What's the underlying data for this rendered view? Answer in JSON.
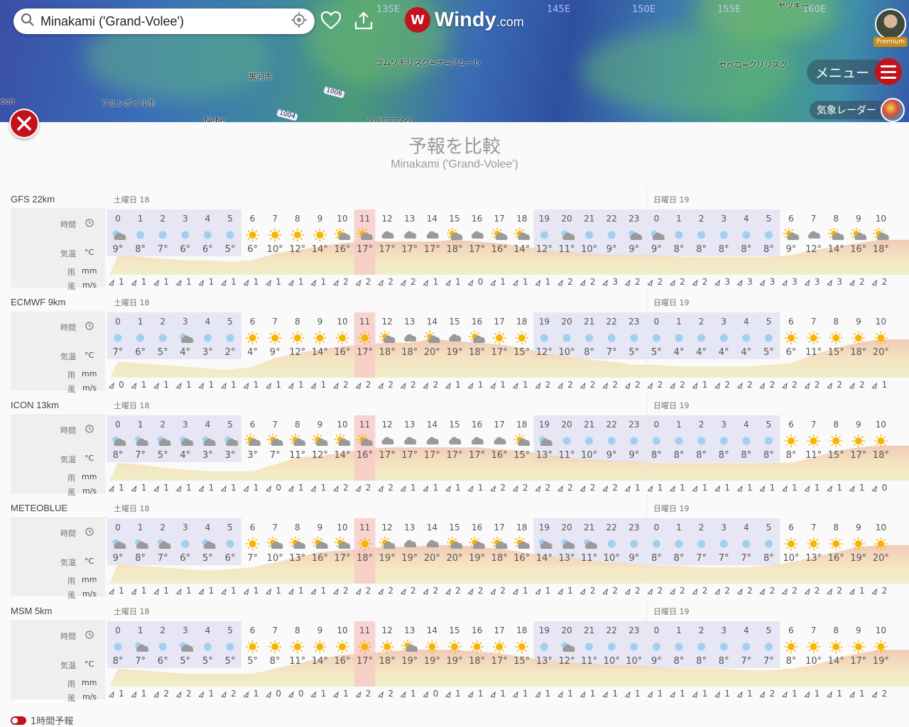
{
  "map": {
    "search_value": "Minakami ('Grand-Volee')",
    "logo_name": "Windy",
    "logo_suffix": ".com",
    "premium_label": "Premium",
    "menu_label": "メニュー",
    "radar_label": "気象レーダー",
    "place_labels": [
      "黒河市",
      "フルンボイル市",
      "コムソモリスク=ナ=アムーレ",
      "セベロ=クリリスク",
      "ヤツキー",
      "ハバロフスク",
      "Nehe",
      "een"
    ],
    "lon_labels": [
      "135E",
      "145E",
      "150E",
      "155E",
      "160E"
    ],
    "isobars": [
      "1006",
      "1004"
    ]
  },
  "page": {
    "title": "予報を比較",
    "subtitle": "Minakami ('Grand-Volee')",
    "toggle_label": "1時間予報"
  },
  "row_labels": {
    "time": "時間",
    "temp": "気温",
    "temp_unit": "°C",
    "rain": "雨",
    "rain_unit": "mm",
    "wind": "風",
    "wind_unit": "m/s"
  },
  "days": [
    "土曜日 18",
    "日曜日 19"
  ],
  "hours": [
    0,
    1,
    2,
    3,
    4,
    5,
    6,
    7,
    8,
    9,
    10,
    11,
    12,
    13,
    14,
    15,
    16,
    17,
    18,
    19,
    20,
    21,
    22,
    23,
    0,
    1,
    2,
    3,
    4,
    5,
    6,
    7,
    8,
    9,
    10
  ],
  "highlight_hour_index": 11,
  "models": [
    {
      "name": "GFS 22km",
      "temps": [
        "9°",
        "8°",
        "7°",
        "6°",
        "6°",
        "5°",
        "6°",
        "10°",
        "12°",
        "14°",
        "16°",
        "17°",
        "17°",
        "17°",
        "17°",
        "18°",
        "17°",
        "16°",
        "14°",
        "12°",
        "11°",
        "10°",
        "9°",
        "9°",
        "9°",
        "8°",
        "8°",
        "8°",
        "8°",
        "8°",
        "9°",
        "12°",
        "14°",
        "16°",
        "18°"
      ],
      "icons": [
        "pc-night",
        "moon",
        "moon",
        "moon",
        "moon",
        "moon",
        "sun",
        "sun",
        "sun",
        "sun",
        "pc-sun",
        "pc-sun",
        "cloud",
        "cloud",
        "cloud",
        "pc-sun",
        "cloud",
        "pc-sun",
        "pc-sun",
        "moon",
        "pc-night",
        "moon",
        "moon",
        "pc-night",
        "pc-night",
        "moon",
        "moon",
        "moon",
        "moon",
        "moon",
        "pc-sun",
        "cloud",
        "pc-sun",
        "pc-sun",
        "pc-sun"
      ],
      "wind": [
        "1",
        "1",
        "1",
        "1",
        "1",
        "1",
        "1",
        "1",
        "1",
        "1",
        "2",
        "2",
        "2",
        "2",
        "1",
        "1",
        "0",
        "1",
        "1",
        "1",
        "2",
        "2",
        "3",
        "2",
        "2",
        "2",
        "2",
        "3",
        "3",
        "3",
        "3",
        "3",
        "3",
        "2",
        "2"
      ]
    },
    {
      "name": "ECMWF 9km",
      "temps": [
        "7°",
        "6°",
        "5°",
        "4°",
        "3°",
        "2°",
        "4°",
        "9°",
        "12°",
        "14°",
        "16°",
        "17°",
        "18°",
        "18°",
        "20°",
        "19°",
        "18°",
        "17°",
        "15°",
        "12°",
        "10°",
        "8°",
        "7°",
        "5°",
        "5°",
        "4°",
        "4°",
        "4°",
        "4°",
        "5°",
        "6°",
        "11°",
        "15°",
        "18°",
        "20°"
      ],
      "icons": [
        "moon",
        "moon",
        "moon",
        "pc-night",
        "moon",
        "moon",
        "sun",
        "sun",
        "sun",
        "sun",
        "sun",
        "sun",
        "pc-sun",
        "cloud",
        "pc-sun",
        "cloud",
        "pc-sun",
        "sun",
        "sun",
        "moon",
        "moon",
        "moon",
        "moon",
        "moon",
        "moon",
        "moon",
        "moon",
        "moon",
        "moon",
        "moon",
        "sun",
        "sun",
        "sun",
        "sun",
        "sun"
      ],
      "wind": [
        "0",
        "1",
        "1",
        "1",
        "1",
        "1",
        "1",
        "1",
        "1",
        "1",
        "2",
        "2",
        "2",
        "2",
        "2",
        "1",
        "1",
        "1",
        "1",
        "2",
        "2",
        "2",
        "2",
        "2",
        "2",
        "2",
        "1",
        "2",
        "2",
        "2",
        "2",
        "2",
        "2",
        "2",
        "1"
      ]
    },
    {
      "name": "ICON 13km",
      "temps": [
        "8°",
        "7°",
        "5°",
        "4°",
        "3°",
        "3°",
        "3°",
        "7°",
        "11°",
        "12°",
        "14°",
        "16°",
        "17°",
        "17°",
        "17°",
        "17°",
        "17°",
        "16°",
        "15°",
        "13°",
        "11°",
        "10°",
        "9°",
        "9°",
        "8°",
        "8°",
        "8°",
        "8°",
        "8°",
        "8°",
        "8°",
        "11°",
        "15°",
        "17°",
        "18°"
      ],
      "icons": [
        "pc-night",
        "pc-night",
        "pc-night",
        "pc-night",
        "pc-night",
        "pc-night",
        "pc-sun",
        "pc-sun",
        "pc-sun",
        "pc-sun",
        "pc-sun",
        "pc-sun",
        "cloud",
        "cloud",
        "cloud",
        "cloud",
        "cloud",
        "cloud",
        "pc-sun",
        "pc-night",
        "moon",
        "moon",
        "moon",
        "moon",
        "moon",
        "moon",
        "moon",
        "moon",
        "moon",
        "moon",
        "sun",
        "sun",
        "sun",
        "sun",
        "sun"
      ],
      "wind": [
        "1",
        "1",
        "1",
        "1",
        "1",
        "1",
        "1",
        "0",
        "1",
        "1",
        "2",
        "2",
        "2",
        "1",
        "1",
        "1",
        "1",
        "2",
        "2",
        "2",
        "2",
        "2",
        "2",
        "1",
        "1",
        "1",
        "1",
        "1",
        "1",
        "1",
        "1",
        "1",
        "1",
        "1",
        "0"
      ]
    },
    {
      "name": "METEOBLUE",
      "temps": [
        "9°",
        "8°",
        "7°",
        "6°",
        "5°",
        "6°",
        "7°",
        "10°",
        "13°",
        "16°",
        "17°",
        "18°",
        "19°",
        "19°",
        "20°",
        "20°",
        "19°",
        "18°",
        "16°",
        "14°",
        "13°",
        "11°",
        "10°",
        "9°",
        "8°",
        "8°",
        "7°",
        "7°",
        "7°",
        "8°",
        "10°",
        "13°",
        "16°",
        "19°",
        "20°"
      ],
      "icons": [
        "pc-night",
        "pc-night",
        "pc-night",
        "moon",
        "pc-night",
        "moon",
        "sun",
        "pc-sun",
        "pc-sun",
        "pc-sun",
        "pc-sun",
        "sun",
        "pc-sun",
        "cloud",
        "cloud",
        "pc-sun",
        "pc-sun",
        "pc-sun",
        "pc-sun",
        "pc-night",
        "pc-night",
        "pc-night",
        "moon",
        "moon",
        "moon",
        "moon",
        "moon",
        "moon",
        "moon",
        "moon",
        "sun",
        "sun",
        "sun",
        "sun",
        "sun"
      ],
      "wind": [
        "1",
        "1",
        "1",
        "1",
        "1",
        "1",
        "1",
        "1",
        "1",
        "1",
        "2",
        "2",
        "2",
        "2",
        "2",
        "2",
        "2",
        "2",
        "1",
        "1",
        "1",
        "2",
        "2",
        "2",
        "2",
        "2",
        "2",
        "2",
        "2",
        "2",
        "2",
        "2",
        "2",
        "1",
        "2"
      ]
    },
    {
      "name": "MSM 5km",
      "temps": [
        "8°",
        "7°",
        "6°",
        "5°",
        "5°",
        "5°",
        "5°",
        "8°",
        "11°",
        "14°",
        "16°",
        "17°",
        "18°",
        "19°",
        "19°",
        "19°",
        "18°",
        "17°",
        "15°",
        "13°",
        "12°",
        "11°",
        "10°",
        "10°",
        "9°",
        "8°",
        "8°",
        "8°",
        "7°",
        "7°",
        "8°",
        "10°",
        "14°",
        "17°",
        "19°"
      ],
      "icons": [
        "moon",
        "pc-night",
        "moon",
        "pc-night",
        "moon",
        "moon",
        "sun",
        "sun",
        "sun",
        "sun",
        "sun",
        "sun",
        "sun",
        "pc-sun",
        "sun",
        "sun",
        "sun",
        "sun",
        "sun",
        "moon",
        "pc-night",
        "moon",
        "moon",
        "moon",
        "moon",
        "moon",
        "moon",
        "moon",
        "moon",
        "moon",
        "sun",
        "sun",
        "sun",
        "sun",
        "sun"
      ],
      "wind": [
        "1",
        "1",
        "2",
        "2",
        "1",
        "2",
        "1",
        "0",
        "0",
        "1",
        "1",
        "2",
        "2",
        "1",
        "0",
        "1",
        "1",
        "1",
        "1",
        "1",
        "1",
        "1",
        "1",
        "1",
        "1",
        "1",
        "1",
        "1",
        "1",
        "2",
        "1",
        "1",
        "1",
        "1",
        "2"
      ]
    }
  ],
  "colors": {
    "brand_red": "#c4121c",
    "night_shade": "#e6e6f4",
    "highlight": "#f7c9c5",
    "temp_fill_warm": "#f0c4b0",
    "temp_fill_cool": "#e9f3c9"
  }
}
